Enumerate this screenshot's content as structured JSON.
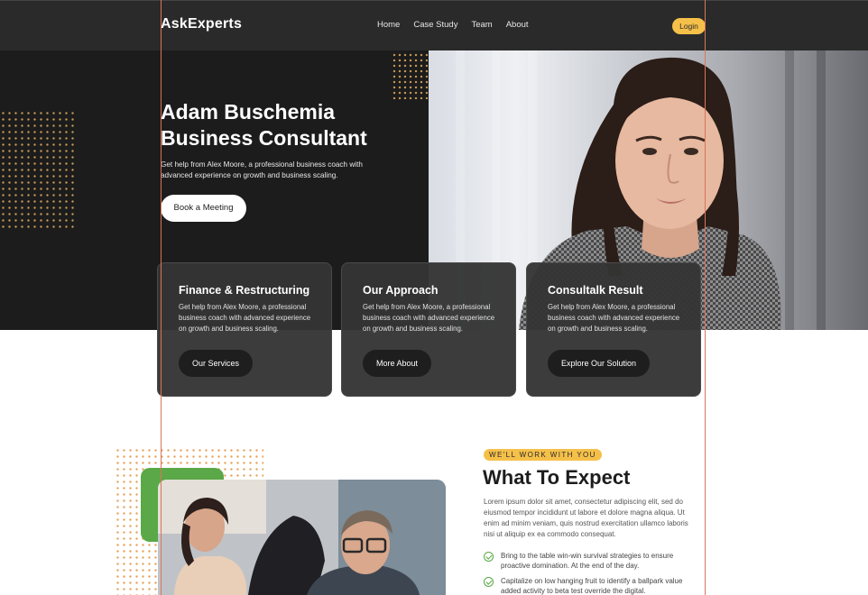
{
  "nav": {
    "brand": "AskExperts",
    "links": [
      "Home",
      "Case Study",
      "Team",
      "About"
    ],
    "login": "Login"
  },
  "hero": {
    "title_line1": "Adam Buschemia",
    "title_line2": "Business Consultant",
    "text": "Get help from Alex Moore, a professional business coach with advanced experience on growth and business scaling.",
    "button": "Book a Meeting"
  },
  "cards": [
    {
      "title": "Finance & Restructuring",
      "text": "Get help from Alex Moore, a professional business coach with advanced experience on growth and business scaling.",
      "button": "Our Services"
    },
    {
      "title": "Our Approach",
      "text": "Get help from Alex Moore, a professional business coach with advanced experience on growth and business scaling.",
      "button": "More About"
    },
    {
      "title": "Consultalk Result",
      "text": "Get help from Alex Moore, a professional business coach with advanced experience on growth and business scaling.",
      "button": "Explore Our Solution"
    }
  ],
  "expect": {
    "tagline": "WE'LL WORK WITH YOU",
    "title": "What To Expect",
    "text": "Lorem ipsum dolor sit amet, consectetur adipiscing elit, sed do eiusmod tempor incididunt ut labore et dolore magna aliqua. Ut enim ad minim veniam, quis nostrud exercitation ullamco laboris nisi ut aliquip ex ea commodo consequat.",
    "items": [
      "Bring to the table win-win survival strategies to ensure proactive domination. At the end of the day.",
      "Capitalize on low hanging fruit to identify a ballpark value added activity to beta test override the digital."
    ]
  },
  "colors": {
    "accent": "#f5c04a",
    "green": "#5aa847",
    "dark": "#1c1c1c",
    "guide": "#d9765b"
  }
}
